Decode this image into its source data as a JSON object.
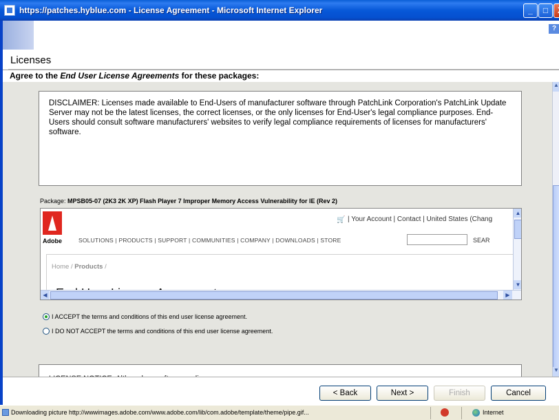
{
  "window": {
    "title": "https://patches.hyblue.com - License Agreement - Microsoft Internet Explorer",
    "min_glyph": "_",
    "max_glyph": "□",
    "close_glyph": "X"
  },
  "header": {
    "help_glyph": "?",
    "page_title": "Licenses",
    "subtitle_prefix": "Agree to the ",
    "subtitle_emphasis": "End User License Agreements",
    "subtitle_suffix": " for these packages:"
  },
  "disclaimer": {
    "text": "DISCLAIMER: Licenses made available to End-Users of manufacturer software through PatchLink Corporation's PatchLink Update Server may not be the latest licenses, the correct licenses, or the only licenses for End-User's legal compliance purposes. End-Users should consult software manufacturers' websites to verify legal compliance requirements of licenses for manufacturers' software."
  },
  "package": {
    "label": "Package: ",
    "name": "MPSB05-07 (2K3 2K XP) Flash Player 7 Improper Memory Access Vulnerability for IE (Rev 2)"
  },
  "embedded_site": {
    "logo_word": "Adobe",
    "top_links": "| Your Account | Contact | United States (Chang",
    "nav": "SOLUTIONS | PRODUCTS | SUPPORT | COMMUNITIES | COMPANY | DOWNLOADS | STORE",
    "search_label": "SEAR",
    "breadcrumb_home": "Home / ",
    "breadcrumb_current": "Products",
    "breadcrumb_tail": " /",
    "heading": "End User License Agreements"
  },
  "agreement": {
    "accept_label": "I ACCEPT the terms and conditions of this end user license agreement.",
    "decline_label": "I DO NOT ACCEPT the terms and conditions of this end user license agreement.",
    "selected": "accept"
  },
  "license_notice": {
    "text": "LICENSE NOTICE: Although ... software ... licenses ... "
  },
  "buttons": {
    "back": "< Back",
    "next": "Next >",
    "finish": "Finish",
    "cancel": "Cancel"
  },
  "statusbar": {
    "text": "Downloading picture http://wwwimages.adobe.com/www.adobe.com/lib/com.adobe/template/theme/pipe.gif...",
    "zone": "Internet"
  },
  "colors": {
    "titlebar": "#0758d8",
    "adobe_red": "#e0271f",
    "radio_selected": "#21a121"
  }
}
